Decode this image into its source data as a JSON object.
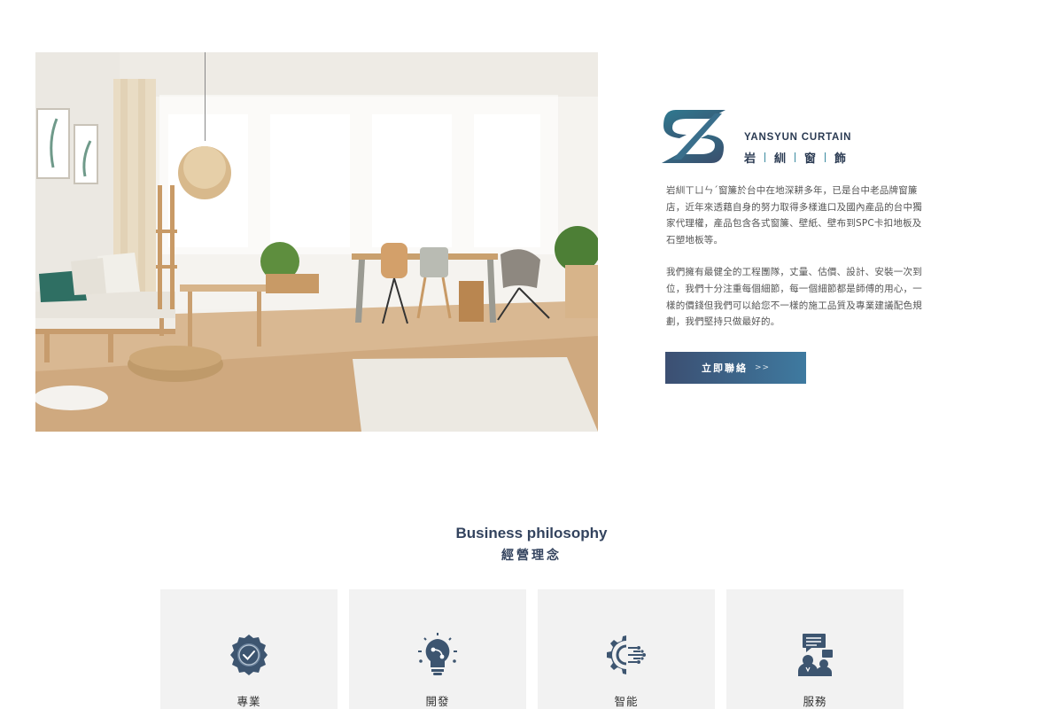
{
  "brand": {
    "name_en": "YANSYUN CURTAIN",
    "name_zh_chars": [
      "岩",
      "紃",
      "窗",
      "飾"
    ]
  },
  "intro": {
    "paragraph1": "岩紃ㄒㄩㄣˊ窗簾於台中在地深耕多年，已是台中老品牌窗簾店，近年來透藉自身的努力取得多樣進口及國內產品的台中獨家代理權，產品包含各式窗簾、壁紙、壁布到SPC卡扣地板及石塑地板等。",
    "paragraph2": "我們擁有最健全的工程團隊，丈量、估價、設計、安裝一次到位，我們十分注重每個細節，每一個細節都是師傅的用心，一樣的價錢但我們可以給您不一樣的施工品質及專業建議配色規劃，我們堅持只做最好的。"
  },
  "contact_button": {
    "label": "立即聯絡",
    "arrow": ">>"
  },
  "philosophy": {
    "title": "Business philosophy",
    "subtitle": "經營理念",
    "cards": [
      {
        "label": "專業",
        "icon": "badge-check-icon"
      },
      {
        "label": "開發",
        "icon": "lightbulb-idea-icon"
      },
      {
        "label": "智能",
        "icon": "gear-circuit-icon"
      },
      {
        "label": "服務",
        "icon": "customer-service-icon"
      }
    ]
  },
  "colors": {
    "accent_dark": "#2a3a52",
    "accent_teal": "#3e7aa0",
    "icon": "#3d5570",
    "card_bg": "#f2f2f2"
  }
}
